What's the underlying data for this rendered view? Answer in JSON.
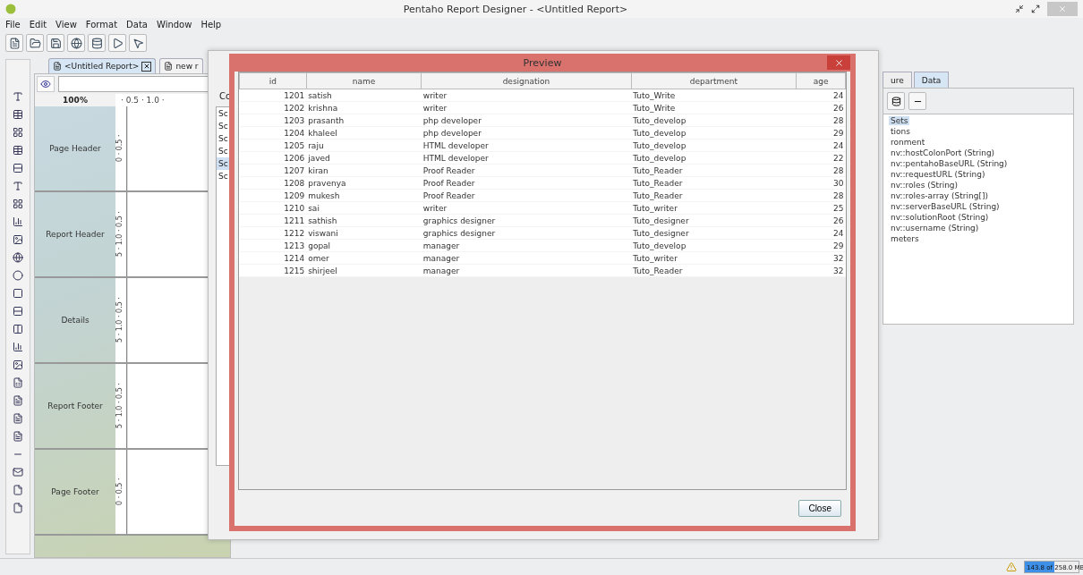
{
  "window": {
    "title": "Pentaho Report Designer - <Untitled Report>"
  },
  "menu": [
    "File",
    "Edit",
    "View",
    "Format",
    "Data",
    "Window",
    "Help"
  ],
  "editor_tabs": [
    {
      "label": "<Untitled Report>",
      "selected": true,
      "closable": true
    },
    {
      "label": "new r",
      "selected": false,
      "closable": false
    }
  ],
  "zoom": "100%",
  "ruler": "· 0.5 · 1.0 ·",
  "bands": [
    {
      "label": "Page Header",
      "ruler": "0 · 0.5 ·"
    },
    {
      "label": "Report Header",
      "ruler": "5 · 1.0 · 0.5 ·"
    },
    {
      "label": "Details",
      "ruler": "5 · 1.0 · 0.5 ·"
    },
    {
      "label": "Report Footer",
      "ruler": "5 · 1.0 · 0.5 ·"
    },
    {
      "label": "Page Footer",
      "ruler": "0 · 0.5 ·"
    }
  ],
  "jdbc_dialog": {
    "label": "Co",
    "items": [
      {
        "text": "Sc",
        "selected": false
      },
      {
        "text": "Sc",
        "selected": false
      },
      {
        "text": "Sc",
        "selected": false
      },
      {
        "text": "Sc",
        "selected": false
      },
      {
        "text": "Sc",
        "selected": true
      },
      {
        "text": "Sc",
        "selected": false
      }
    ]
  },
  "preview": {
    "title": "Preview",
    "columns": [
      "id",
      "name",
      "designation",
      "department",
      "age"
    ],
    "rows": [
      [
        "1201",
        "satish",
        "writer",
        "Tuto_Write",
        "24"
      ],
      [
        "1202",
        "krishna",
        "writer",
        "Tuto_Write",
        "26"
      ],
      [
        "1203",
        "prasanth",
        "php developer",
        "Tuto_develop",
        "28"
      ],
      [
        "1204",
        "khaleel",
        "php developer",
        "Tuto_develop",
        "29"
      ],
      [
        "1205",
        "raju",
        "HTML developer",
        "Tuto_develop",
        "24"
      ],
      [
        "1206",
        "javed",
        "HTML developer",
        "Tuto_develop",
        "22"
      ],
      [
        "1207",
        "kiran",
        "Proof Reader",
        "Tuto_Reader",
        "28"
      ],
      [
        "1208",
        "pravenya",
        "Proof Reader",
        "Tuto_Reader",
        "30"
      ],
      [
        "1209",
        "mukesh",
        "Proof Reader",
        "Tuto_Reader",
        "28"
      ],
      [
        "1210",
        "sai",
        "writer",
        "Tuto_writer",
        "25"
      ],
      [
        "1211",
        "sathish",
        "graphics designer",
        "Tuto_designer",
        "26"
      ],
      [
        "1212",
        "viswani",
        "graphics designer",
        "Tuto_designer",
        "24"
      ],
      [
        "1213",
        "gopal",
        "manager",
        "Tuto_develop",
        "29"
      ],
      [
        "1214",
        "omer",
        "manager",
        "Tuto_writer",
        "32"
      ],
      [
        "1215",
        "shirjeel",
        "manager",
        "Tuto_Reader",
        "32"
      ]
    ],
    "close_button": "Close"
  },
  "side_tabs": [
    {
      "label": "ure",
      "selected": false
    },
    {
      "label": "Data",
      "selected": true
    }
  ],
  "data_tree": [
    {
      "text": "Sets",
      "selected": true
    },
    {
      "text": "tions",
      "selected": false
    },
    {
      "text": "ronment",
      "selected": false
    },
    {
      "text": "nv::hostColonPort (String)",
      "selected": false
    },
    {
      "text": "nv::pentahoBaseURL (String)",
      "selected": false
    },
    {
      "text": "nv::requestURL (String)",
      "selected": false
    },
    {
      "text": "nv::roles (String)",
      "selected": false
    },
    {
      "text": "nv::roles-array (String[])",
      "selected": false
    },
    {
      "text": "nv::serverBaseURL (String)",
      "selected": false
    },
    {
      "text": "nv::solutionRoot (String)",
      "selected": false
    },
    {
      "text": "nv::username (String)",
      "selected": false
    },
    {
      "text": "meters",
      "selected": false
    }
  ],
  "status_bar": {
    "memory": "143.8 of 258.0 MB",
    "level": 0.55
  }
}
